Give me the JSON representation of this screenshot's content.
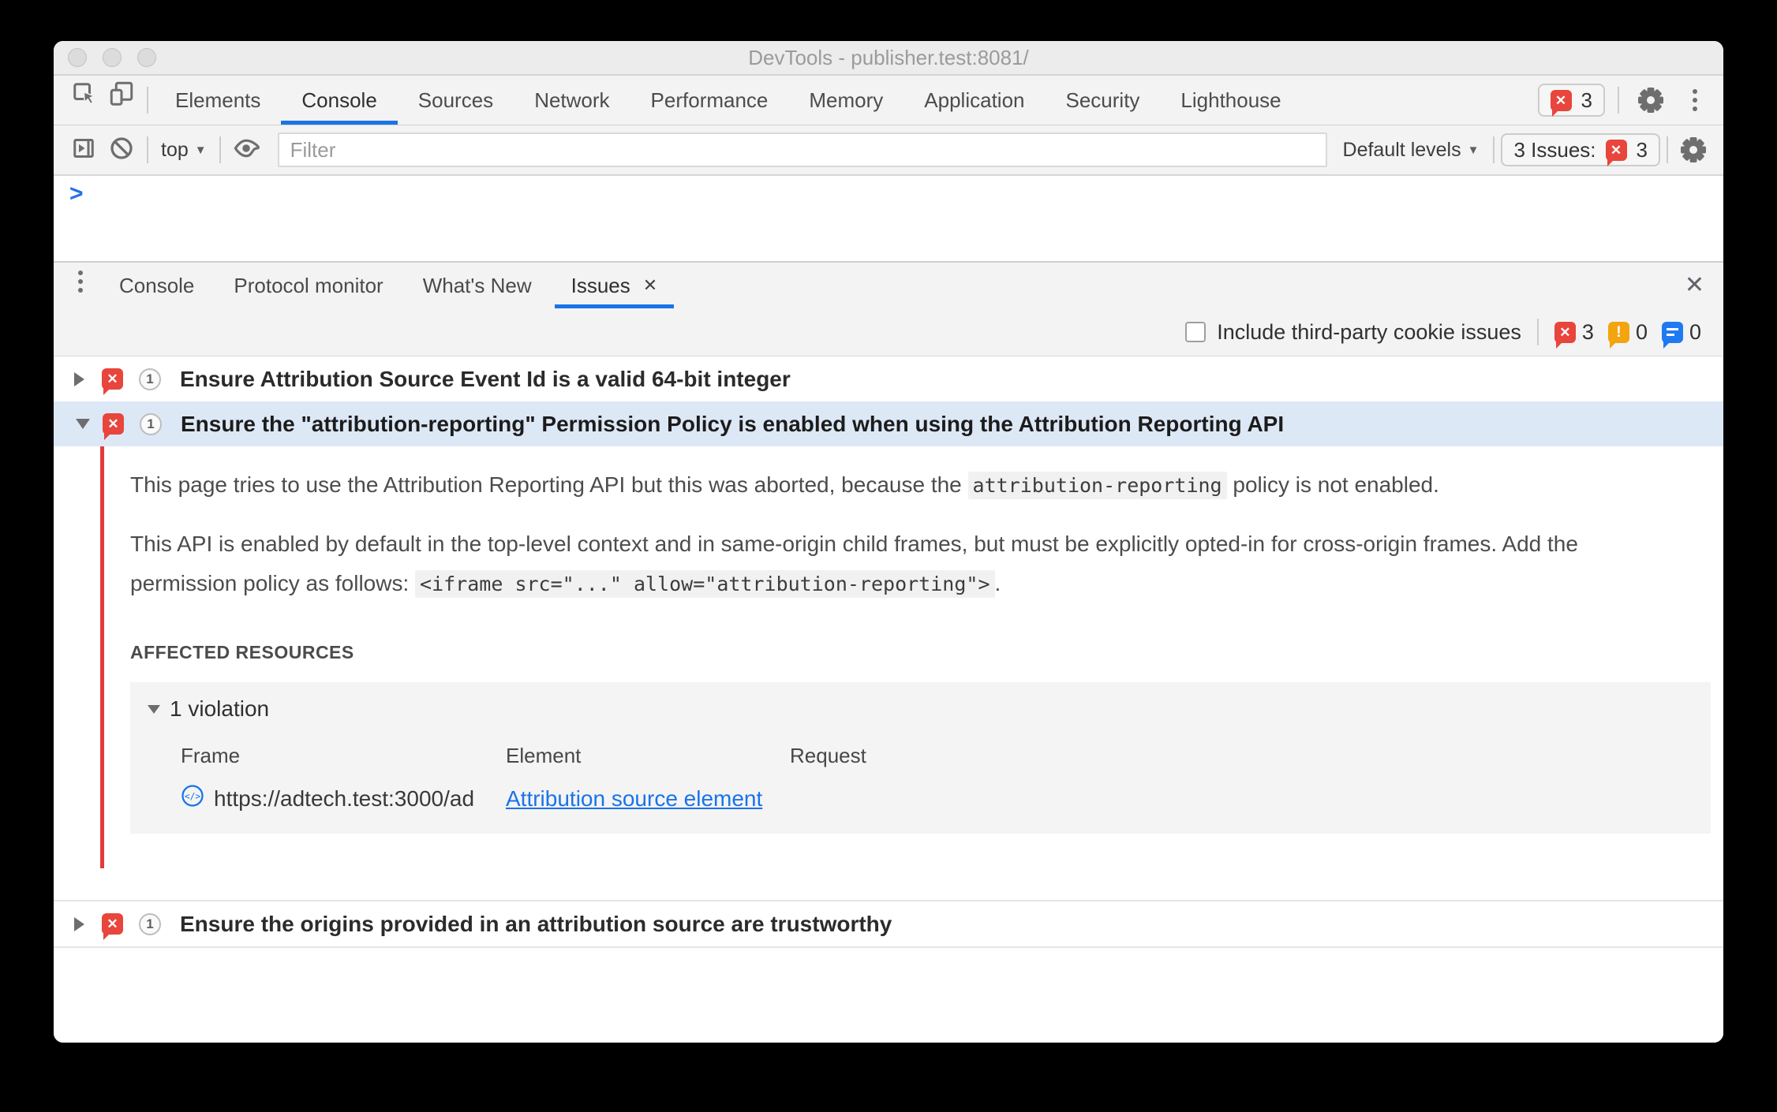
{
  "window": {
    "title": "DevTools - publisher.test:8081/"
  },
  "colors": {
    "accent_blue": "#1a73e8",
    "error_red": "#e8453c",
    "warning_orange": "#f2a50f",
    "info_blue": "#1f7af2",
    "selected_row": "#dde8f6",
    "issue_rule_red": "#e33b3b"
  },
  "icons": {
    "inspect": "cursor-in-box",
    "device_toolbar": "phone-over-tablet",
    "console_sidebar": "panel-with-play",
    "clear_console": "circle-slash",
    "live_expression": "eye",
    "settings": "gear",
    "more": "kebab-dots",
    "error": "red-x-speech-bubble",
    "warning": "orange-exclamation-bubble",
    "info": "blue-text-bubble",
    "frame": "code-in-circle",
    "close": "x"
  },
  "tabbar": {
    "tabs": [
      {
        "label": "Elements"
      },
      {
        "label": "Console"
      },
      {
        "label": "Sources"
      },
      {
        "label": "Network"
      },
      {
        "label": "Performance"
      },
      {
        "label": "Memory"
      },
      {
        "label": "Application"
      },
      {
        "label": "Security"
      },
      {
        "label": "Lighthouse"
      }
    ],
    "error_count": "3"
  },
  "console_toolbar": {
    "context": "top",
    "filter_placeholder": "Filter",
    "levels_label": "Default levels",
    "issues_label": "3 Issues:",
    "issues_count": "3"
  },
  "console": {
    "prompt": ">"
  },
  "drawer": {
    "tabs": [
      {
        "label": "Console"
      },
      {
        "label": "Protocol monitor"
      },
      {
        "label": "What's New"
      },
      {
        "label": "Issues"
      }
    ]
  },
  "issues_toolbar": {
    "checkbox_label": "Include third-party cookie issues",
    "error_count": "3",
    "warning_count": "0",
    "info_count": "0"
  },
  "issues": {
    "item1": {
      "count": "1",
      "title": "Ensure Attribution Source Event Id is a valid 64-bit integer"
    },
    "item2": {
      "count": "1",
      "title": "Ensure the \"attribution-reporting\" Permission Policy is enabled when using the Attribution Reporting API",
      "p1_before": "This page tries to use the Attribution Reporting API but this was aborted, because the ",
      "p1_code": "attribution-reporting",
      "p1_after": " policy is not enabled.",
      "p2_before": "This API is enabled by default in the top-level context and in same-origin child frames, but must be explicitly opted-in for cross-origin frames. Add the permission policy as follows: ",
      "p2_code": "<iframe src=\"...\" allow=\"attribution-reporting\">",
      "p2_after": ".",
      "affected_title": "AFFECTED RESOURCES",
      "violations_label": "1 violation",
      "col_frame": "Frame",
      "col_element": "Element",
      "col_request": "Request",
      "frame_url": "https://adtech.test:3000/ad",
      "element_link": "Attribution source element"
    },
    "item3": {
      "count": "1",
      "title": "Ensure the origins provided in an attribution source are trustworthy"
    }
  }
}
